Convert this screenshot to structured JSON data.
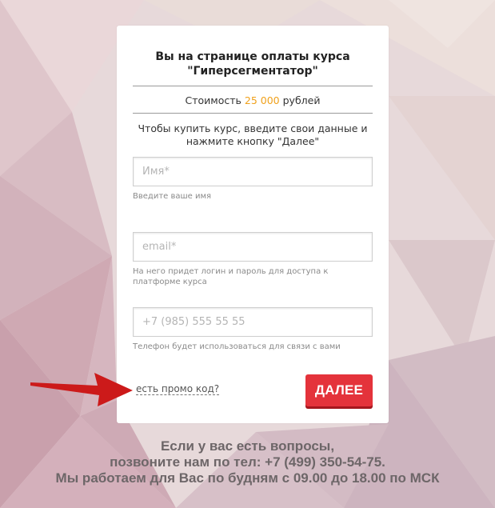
{
  "colors": {
    "accent": "#f0a11b",
    "button": "#e4333b",
    "arrow": "#cc1a1a"
  },
  "card": {
    "title_line1": "Вы на странице оплаты курса",
    "title_line2": "\"Гиперсегментатор\"",
    "price_prefix": "Стоимость",
    "price_amount": "25 000",
    "price_suffix": "рублей",
    "intro_line1": "Чтобы купить курс, введите свои данные и",
    "intro_line2": "нажмите кнопку \"Далее\""
  },
  "form": {
    "name": {
      "placeholder": "Имя*",
      "value": "",
      "hint": "Введите ваше имя"
    },
    "email": {
      "placeholder": "email*",
      "value": "",
      "hint": "На него придет логин и пароль для доступа к платформе курса"
    },
    "phone": {
      "placeholder": "+7 (985) 555 55 55",
      "value": "",
      "hint": "Телефон будет использоваться для связи с вами"
    },
    "promo_link": "есть промо код?",
    "next_button": "ДАЛЕЕ"
  },
  "footer": {
    "line1": "Если у вас есть вопросы,",
    "line2": "позвоните нам по тел: +7 (499) 350-54-75.",
    "line3": "Мы работаем для Вас по будням с 09.00 до 18.00 по МСК"
  },
  "icons": {
    "arrow": "arrow-right-icon"
  }
}
